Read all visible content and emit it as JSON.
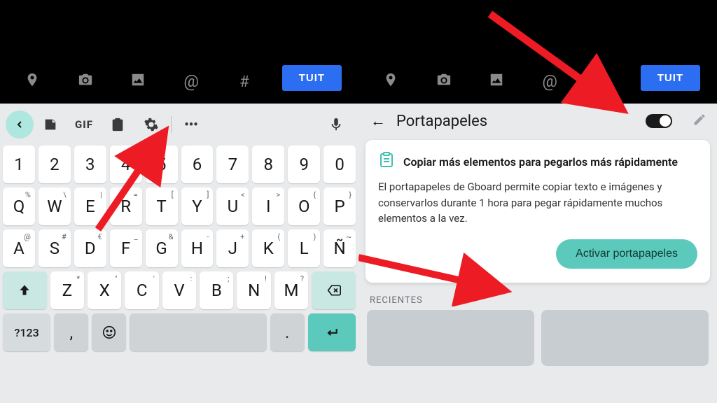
{
  "top": {
    "tuit_label": "TUIT"
  },
  "keyboard": {
    "toolbar": {
      "gif": "GIF"
    },
    "row1": [
      {
        "m": "1"
      },
      {
        "m": "2"
      },
      {
        "m": "3"
      },
      {
        "m": "4"
      },
      {
        "m": "5"
      },
      {
        "m": "6"
      },
      {
        "m": "7"
      },
      {
        "m": "8"
      },
      {
        "m": "9"
      },
      {
        "m": "0"
      }
    ],
    "row2": [
      {
        "m": "Q",
        "s": "%"
      },
      {
        "m": "W",
        "s": "\\"
      },
      {
        "m": "E",
        "s": "|"
      },
      {
        "m": "R",
        "s": "="
      },
      {
        "m": "T",
        "s": "["
      },
      {
        "m": "Y",
        "s": "]"
      },
      {
        "m": "U",
        "s": "<"
      },
      {
        "m": "I",
        "s": ">"
      },
      {
        "m": "O",
        "s": "{"
      },
      {
        "m": "P",
        "s": "}"
      }
    ],
    "row3": [
      {
        "m": "A",
        "s": "@"
      },
      {
        "m": "S",
        "s": "#"
      },
      {
        "m": "D",
        "s": "€"
      },
      {
        "m": "F",
        "s": "_"
      },
      {
        "m": "G",
        "s": "&"
      },
      {
        "m": "H",
        "s": "-"
      },
      {
        "m": "J",
        "s": "+"
      },
      {
        "m": "K",
        "s": "("
      },
      {
        "m": "L",
        "s": ")"
      },
      {
        "m": "Ñ",
        "s": "~"
      }
    ],
    "row4": [
      {
        "m": "Z",
        "s": "*"
      },
      {
        "m": "X",
        "s": "\""
      },
      {
        "m": "C",
        "s": "'"
      },
      {
        "m": "V",
        "s": ":"
      },
      {
        "m": "B",
        "s": ";"
      },
      {
        "m": "N",
        "s": "!"
      },
      {
        "m": "M",
        "s": "?"
      }
    ],
    "bottom": {
      "sym": "?123",
      "comma": ",",
      "period": "."
    }
  },
  "clipboard": {
    "title": "Portapapeles",
    "card_title": "Copiar más elementos para pegarlos más rápidamente",
    "card_body": "El portapapeles de Gboard permite copiar texto e imágenes y conservarlos durante 1 hora para pegar rápidamente muchos elementos a la vez.",
    "activate": "Activar portapapeles",
    "recent_label": "RECIENTES"
  }
}
